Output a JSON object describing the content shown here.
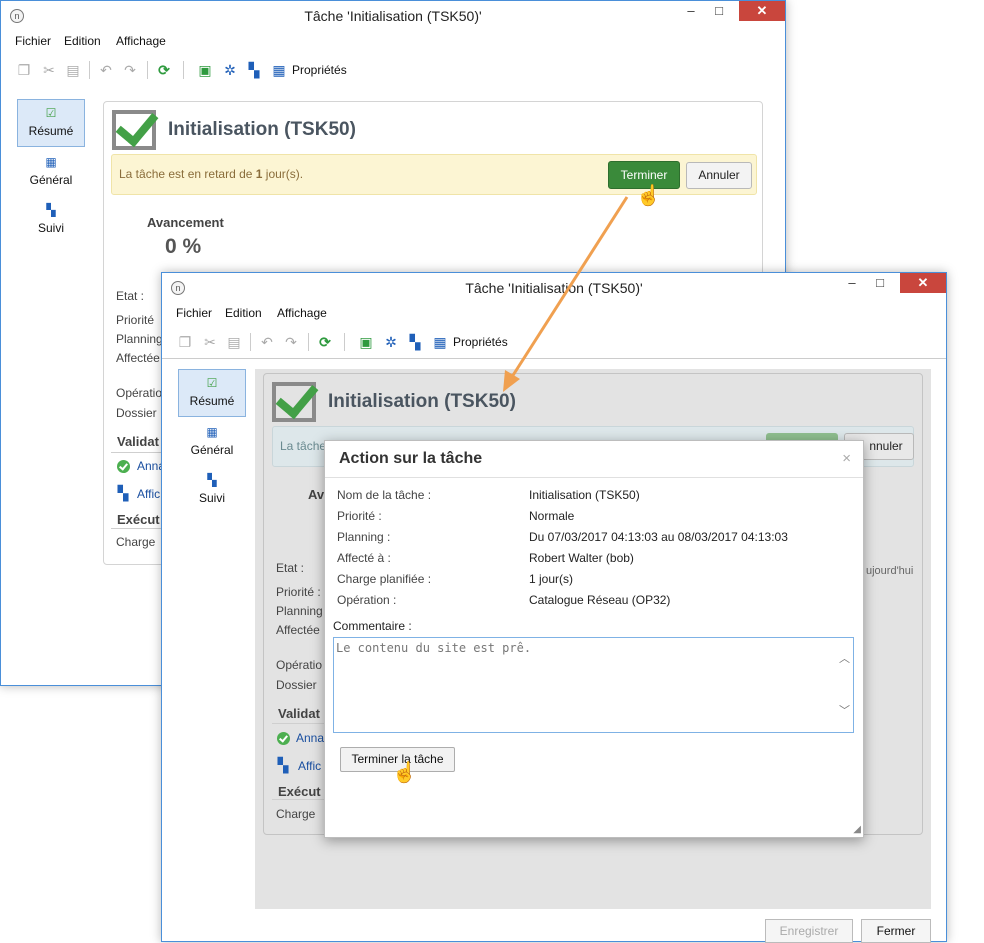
{
  "window_back": {
    "title": "Tâche 'Initialisation (TSK50)'",
    "menu": [
      "Fichier",
      "Edition",
      "Affichage"
    ],
    "toolbar_properties_label": "Propriétés",
    "nav": [
      "Résumé",
      "Général",
      "Suivi"
    ],
    "task_title": "Initialisation (TSK50)",
    "alert_text_pre": "La tâche est en retard de ",
    "alert_text_bold": "1",
    "alert_text_post": " jour(s).",
    "btn_finish": "Terminer",
    "btn_cancel": "Annuler",
    "progress_label": "Avancement",
    "progress_value": "0 %",
    "fields": [
      "Etat :",
      "Priorité",
      "Planning",
      "Affectée",
      "Opératio",
      "Dossier"
    ],
    "section_validation": "Validat",
    "validation_links": [
      "Anna",
      "Affic"
    ],
    "section_execution": "Exécut",
    "execution_field": "Charge"
  },
  "window_front": {
    "title": "Tâche 'Initialisation (TSK50)'",
    "menu": [
      "Fichier",
      "Edition",
      "Affichage"
    ],
    "toolbar_properties_label": "Propriétés",
    "nav": [
      "Résumé",
      "Général",
      "Suivi"
    ],
    "task_title": "Initialisation (TSK50)",
    "alert_text_partial": "La tâche",
    "btn_cancel_partial": "nnuler",
    "progress_label_partial": "Av",
    "fields": [
      "Etat :",
      "Priorité :",
      "Planning",
      "Affectée",
      "Opératio",
      "Dossier"
    ],
    "today_partial": "ujourd'hui",
    "section_validation": "Validat",
    "validation_links": [
      "Anna",
      "Affic"
    ],
    "section_execution": "Exécut",
    "execution_field": "Charge",
    "footer_save": "Enregistrer",
    "footer_close": "Fermer"
  },
  "dialog": {
    "title": "Action sur la tâche",
    "close_glyph": "×",
    "rows": [
      {
        "label": "Nom de la tâche :",
        "value": "Initialisation (TSK50)",
        "link": true
      },
      {
        "label": "Priorité :",
        "value": "Normale",
        "link": false
      },
      {
        "label": "Planning :",
        "value": "Du 07/03/2017 04:13:03 au 08/03/2017 04:13:03",
        "link": false
      },
      {
        "label": "Affecté à :",
        "value": "Robert Walter (bob)",
        "link": false
      },
      {
        "label": "Charge planifiée :",
        "value": "1 jour(s)",
        "link": false
      },
      {
        "label": "Opération :",
        "value": "Catalogue Réseau (OP32)",
        "link": true
      }
    ],
    "comment_label": "Commentaire :",
    "comment_value": "Le contenu du site est prê.",
    "finish_button": "Terminer la tâche"
  },
  "colors": {
    "accent": "#4a8fd9",
    "success": "#3a8a3a",
    "alert_bg": "#fcf5d3",
    "arrow": "#f0a050",
    "close": "#c9463d"
  }
}
